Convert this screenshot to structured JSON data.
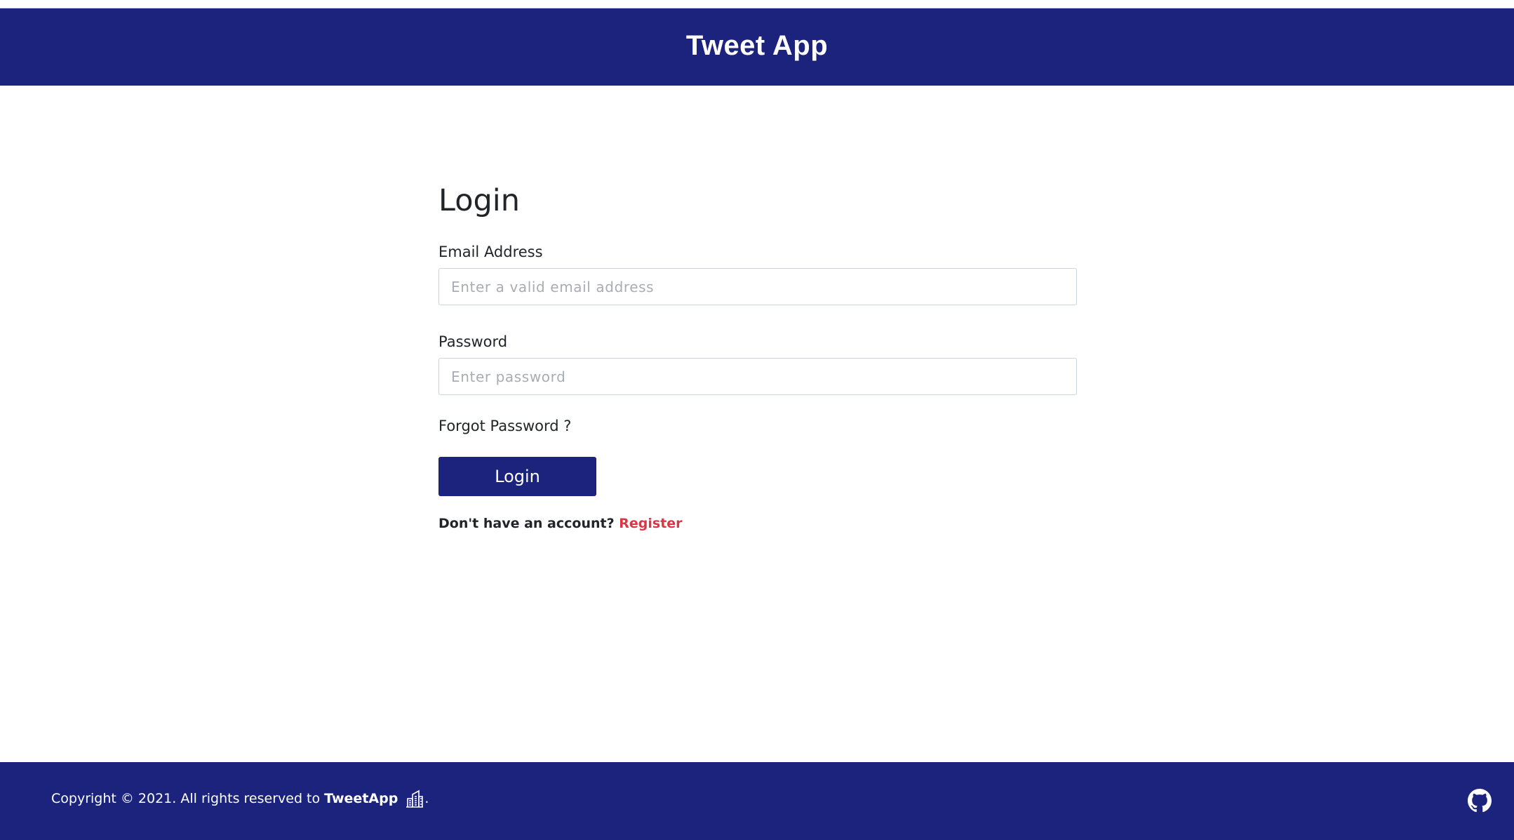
{
  "header": {
    "title": "Tweet App"
  },
  "form": {
    "heading": "Login",
    "email_label": "Email Address",
    "email_placeholder": "Enter a valid email address",
    "email_value": "",
    "password_label": "Password",
    "password_placeholder": "Enter password",
    "password_value": "",
    "forgot_label": "Forgot Password ?",
    "submit_label": "Login",
    "no_account_text": "Don't have an account?",
    "register_label": "Register"
  },
  "footer": {
    "copyright_text": "Copyright © 2021. All rights reserved to",
    "brand": "TweetApp",
    "trailing": ".",
    "building_icon": "building-icon",
    "github_icon": "github-icon"
  },
  "colors": {
    "primary": "#1b237d",
    "link_danger": "#dc3545",
    "text": "#212529"
  }
}
